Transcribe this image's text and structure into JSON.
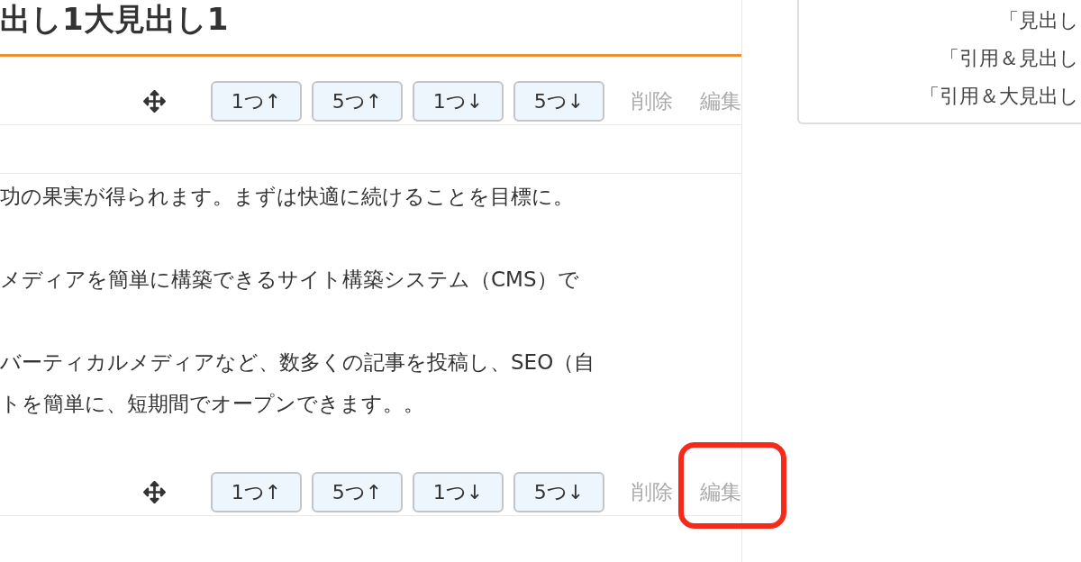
{
  "blocks": [
    {
      "heading": "出し1大見出し1",
      "toolbar": {
        "buttons": [
          "1つ↑",
          "5つ↑",
          "1つ↓",
          "5つ↓"
        ],
        "links": [
          {
            "label": "削除",
            "highlighted": false
          },
          {
            "label": "編集",
            "highlighted": false
          }
        ]
      }
    },
    {
      "paragraphs": [
        {
          "lines": [
            "功の果実が得られます。まずは快適に続けることを目標に。"
          ]
        },
        {
          "lines": [
            "メディアを簡単に構築できるサイト構築システム（CMS）で"
          ]
        },
        {
          "lines": [
            "バーティカルメディアなど、数多くの記事を投稿し、SEO（自",
            "トを簡単に、短期間でオープンできます。。"
          ]
        }
      ],
      "toolbar": {
        "buttons": [
          "1つ↑",
          "5つ↑",
          "1つ↓",
          "5つ↓"
        ],
        "links": [
          {
            "label": "削除",
            "highlighted": false
          },
          {
            "label": "編集",
            "highlighted": true
          }
        ]
      }
    }
  ],
  "side_panel": {
    "lines": [
      "「見出し",
      "「引用＆見出し",
      "「引用＆大見出し"
    ]
  }
}
